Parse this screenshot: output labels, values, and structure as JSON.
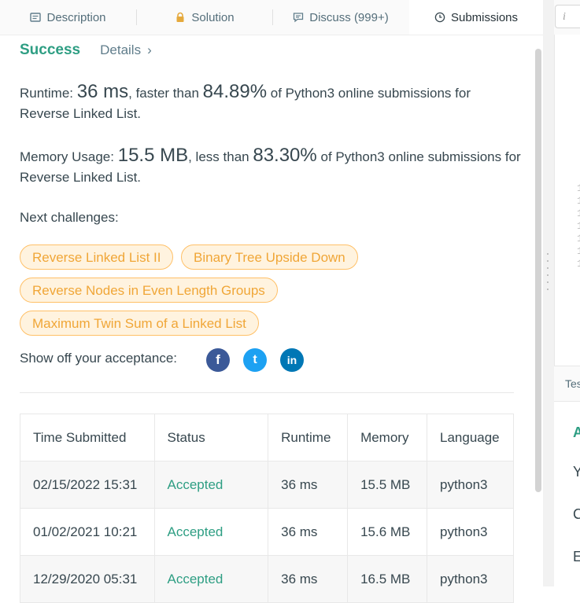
{
  "tabs": [
    {
      "label": "Description",
      "icon": "description-icon"
    },
    {
      "label": "Solution",
      "icon": "lock-icon"
    },
    {
      "label": "Discuss (999+)",
      "icon": "discuss-icon"
    },
    {
      "label": "Submissions",
      "icon": "clock-icon"
    }
  ],
  "result": {
    "status": "Success",
    "details_label": "Details",
    "runtime_label": "Runtime:",
    "runtime_value": "36 ms",
    "runtime_mid": ", faster than",
    "runtime_percent": "84.89%",
    "runtime_tail": "of Python3 online submissions for Reverse Linked List.",
    "memory_label": "Memory Usage:",
    "memory_value": "15.5 MB",
    "memory_mid": ", less than",
    "memory_percent": "83.30%",
    "memory_tail": "of Python3 online submissions for Reverse Linked List."
  },
  "next_challenges": {
    "label": "Next challenges:",
    "items": [
      "Reverse Linked List II",
      "Binary Tree Upside Down",
      "Reverse Nodes in Even Length Groups",
      "Maximum Twin Sum of a Linked List"
    ]
  },
  "share": {
    "label": "Show off your acceptance:",
    "networks": [
      {
        "name": "facebook-icon",
        "glyph": "f",
        "color": "#3b5998"
      },
      {
        "name": "twitter-icon",
        "glyph": "t",
        "color": "#1da1f2"
      },
      {
        "name": "linkedin-icon",
        "glyph": "in",
        "color": "#0077b5"
      }
    ]
  },
  "table": {
    "headers": [
      "Time Submitted",
      "Status",
      "Runtime",
      "Memory",
      "Language"
    ],
    "rows": [
      [
        "02/15/2022 15:31",
        "Accepted",
        "36 ms",
        "15.5 MB",
        "python3"
      ],
      [
        "01/02/2021 10:21",
        "Accepted",
        "36 ms",
        "15.6 MB",
        "python3"
      ],
      [
        "12/29/2020 05:31",
        "Accepted",
        "36 ms",
        "16.5 MB",
        "python3"
      ]
    ]
  },
  "right_panel": {
    "input_hint": "i",
    "test_tab": "Tes",
    "line_digits": [
      "1",
      "1",
      "1",
      "1",
      "1",
      "1",
      "1"
    ],
    "cut_letters": [
      "A",
      "Y",
      "C",
      "E"
    ]
  },
  "colors": {
    "accent": "#2e9e83",
    "chip_border": "#ffc067",
    "chip_text": "#f0a637",
    "chip_bg": "#fff3df"
  }
}
